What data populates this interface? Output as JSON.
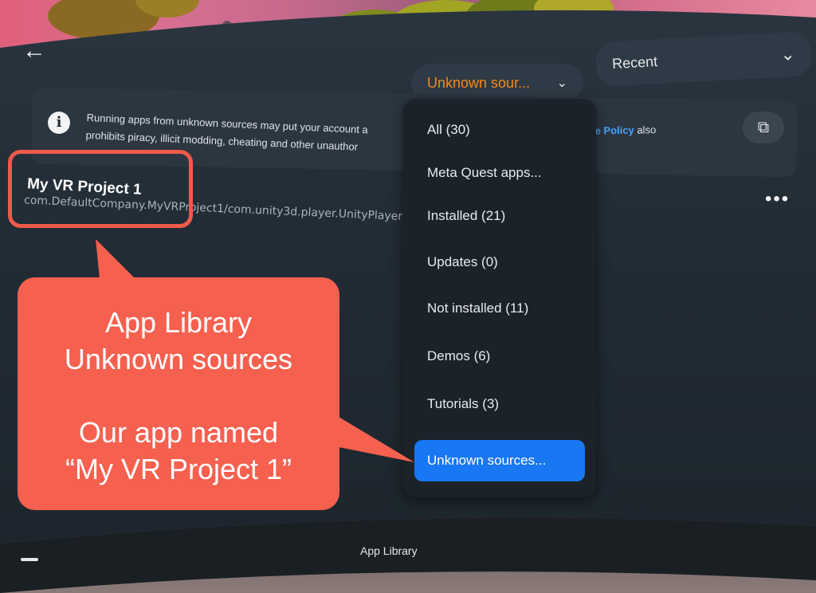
{
  "header": {
    "back_icon": "arrow-left-icon",
    "filter_sources": "Unknown sour...",
    "sort_label": "Recent"
  },
  "banner": {
    "text_line1": "Running apps from unknown sources may put your account a",
    "text_line2": "prohibits piracy, illicit modding, cheating and other unauthor",
    "link": "Use Policy",
    "after_link": " also"
  },
  "app": {
    "title": "My VR Project 1",
    "package": "com.DefaultCompany.MyVRProject1/com.unity3d.player.UnityPlayer"
  },
  "dropdown": {
    "items": [
      "All (30)",
      "Meta Quest apps...",
      "Installed (21)",
      "Updates (0)",
      "Not installed (11)",
      "Demos (6)",
      "Tutorials (3)",
      "Unknown sources..."
    ],
    "selected_index": 7
  },
  "annotation": {
    "line1": "App Library",
    "line2": "Unknown sources",
    "line3": "Our app named",
    "line4": "“My VR Project 1”",
    "color": "#f6604f"
  },
  "bottom_bar": {
    "label": "App Library"
  },
  "colors": {
    "accent_orange": "#f0891f",
    "selection_blue": "#1877f2",
    "panel": "#222c35"
  }
}
